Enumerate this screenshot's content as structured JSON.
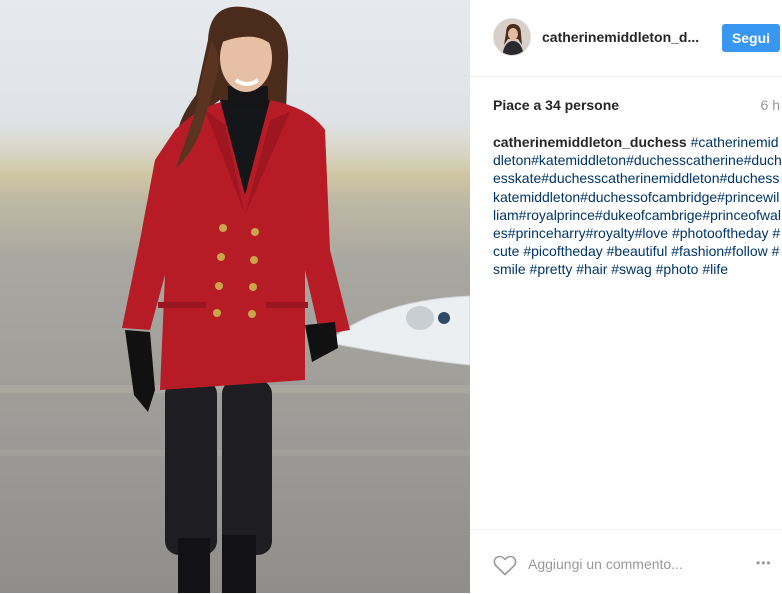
{
  "post": {
    "username": "catherinemiddleton_d...",
    "follow_label": "Segui",
    "likes_text": "Piace a 34 persone",
    "time_ago": "6 h",
    "caption_author": "catherinemiddleton_duchess",
    "caption_hashtags": "#catherinemiddleton#katemiddleton#duchesscatherine#duchesskate#duchesscatherinemiddleton#duchesskatemiddleton#duchessofcambridge#princewilliam#royalprince#dukeofcambrige#princeofwales#princeharry#royalty#love #photooftheday #cute #picoftheday #beautiful #fashion#follow #smile #pretty #hair #swag #photo #life",
    "comment_placeholder": "Aggiungi un commento...",
    "more_glyph": "•••"
  },
  "icons": {
    "like": "heart-outline-icon",
    "options": "more-options-icon"
  },
  "colors": {
    "follow_button": "#3897f0",
    "hashtag": "#003569",
    "muted_text": "#999999",
    "coat": "#b71c26"
  }
}
